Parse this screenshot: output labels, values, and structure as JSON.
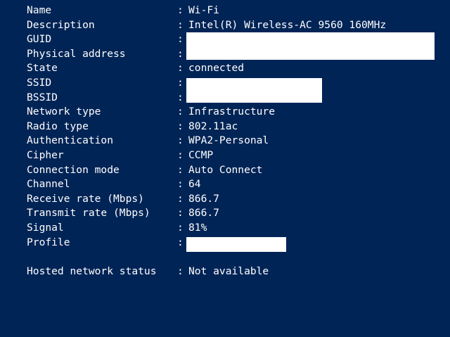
{
  "colors": {
    "background": "#012456",
    "text": "#ffffff",
    "redaction": "#ffffff"
  },
  "separator": ":",
  "interface": {
    "name": {
      "label": "Name",
      "value": "Wi-Fi"
    },
    "description": {
      "label": "Description",
      "value": "Intel(R) Wireless-AC 9560 160MHz"
    },
    "guid": {
      "label": "GUID",
      "value": ""
    },
    "physical_address": {
      "label": "Physical address",
      "value": ""
    },
    "state": {
      "label": "State",
      "value": "connected"
    },
    "ssid": {
      "label": "SSID",
      "value": ""
    },
    "bssid": {
      "label": "BSSID",
      "value": ""
    },
    "network_type": {
      "label": "Network type",
      "value": "Infrastructure"
    },
    "radio_type": {
      "label": "Radio type",
      "value": "802.11ac"
    },
    "authentication": {
      "label": "Authentication",
      "value": "WPA2-Personal"
    },
    "cipher": {
      "label": "Cipher",
      "value": "CCMP"
    },
    "connection_mode": {
      "label": "Connection mode",
      "value": "Auto Connect"
    },
    "channel": {
      "label": "Channel",
      "value": "64"
    },
    "receive_rate": {
      "label": "Receive rate (Mbps)",
      "value": "866.7"
    },
    "transmit_rate": {
      "label": "Transmit rate (Mbps)",
      "value": "866.7"
    },
    "signal": {
      "label": "Signal",
      "value": "81%"
    },
    "profile": {
      "label": "Profile",
      "value": ""
    }
  },
  "hosted_network": {
    "status": {
      "label": "Hosted network status",
      "value": "Not available"
    }
  }
}
